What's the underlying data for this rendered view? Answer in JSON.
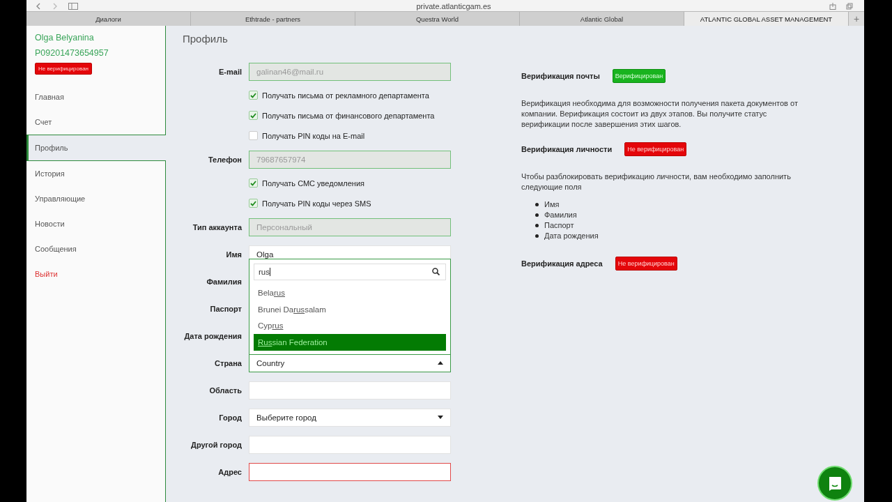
{
  "browser": {
    "url": "private.atlanticgam.es",
    "tabs": [
      {
        "label": "Диалоги",
        "selected": false
      },
      {
        "label": "Ethtrade - partners",
        "selected": false
      },
      {
        "label": "Questra World",
        "selected": false
      },
      {
        "label": "Atlantic Global",
        "selected": false
      },
      {
        "label": "ATLANTIC GLOBAL ASSET MANAGEMENT",
        "selected": true
      }
    ],
    "new_tab": "+"
  },
  "sidebar": {
    "name": "Olga Belyanina",
    "account_id": "P09201473654957",
    "status": {
      "label": "Не верифицирован",
      "verified": false
    },
    "items": [
      {
        "label": "Главная",
        "selected": false,
        "kind": "nav"
      },
      {
        "label": "Счет",
        "selected": false,
        "kind": "nav"
      },
      {
        "label": "Профиль",
        "selected": true,
        "kind": "nav"
      },
      {
        "label": "История",
        "selected": false,
        "kind": "nav"
      },
      {
        "label": "Управляющие",
        "selected": false,
        "kind": "nav"
      },
      {
        "label": "Новости",
        "selected": false,
        "kind": "nav"
      },
      {
        "label": "Сообщения",
        "selected": false,
        "kind": "nav"
      },
      {
        "label": "Выйти",
        "selected": false,
        "kind": "logout"
      }
    ]
  },
  "page_title": "Профиль",
  "form": [
    {
      "kind": "field",
      "label": "E-mail",
      "value": "galinan46@mail.ru",
      "disabled": true,
      "error": false
    },
    {
      "kind": "checkbox",
      "label": "Получать письма от рекламного департамента",
      "checked": true
    },
    {
      "kind": "checkbox",
      "label": "Получать письма от финансового департамента",
      "checked": true
    },
    {
      "kind": "checkbox",
      "label": "Получать PIN коды на E-mail",
      "checked": false
    },
    {
      "kind": "field",
      "label": "Телефон",
      "value": "79687657974",
      "disabled": true,
      "error": false
    },
    {
      "kind": "checkbox",
      "label": "Получать СМС уведомления",
      "checked": true
    },
    {
      "kind": "checkbox",
      "label": "Получать PIN коды через SMS",
      "checked": true
    },
    {
      "kind": "field",
      "label": "Тип аккаунта",
      "value": "Персональный",
      "disabled": true,
      "error": false
    },
    {
      "kind": "field",
      "label": "Имя",
      "value": "Olga",
      "disabled": false,
      "error": false
    },
    {
      "kind": "covered",
      "label": "Фамилия"
    },
    {
      "kind": "covered",
      "label": "Паспорт"
    },
    {
      "kind": "covered",
      "label": "Дата рождения"
    },
    {
      "kind": "country",
      "label": "Страна",
      "value": "Country",
      "expanded": true,
      "search": "rus",
      "options": [
        {
          "before": "Bela",
          "match": "rus",
          "selected": false
        },
        {
          "before": "Brunei Da",
          "match": "rus",
          "after": "salam",
          "selected": false
        },
        {
          "before": "Cyp",
          "match": "rus",
          "selected": false
        },
        {
          "match": "Rus",
          "after": "sian Federation",
          "selected": true
        }
      ]
    },
    {
      "kind": "field",
      "label": "Область",
      "disabled": false,
      "error": false
    },
    {
      "kind": "select",
      "label": "Город",
      "value": "Выберите город"
    },
    {
      "kind": "field",
      "label": "Другой город",
      "disabled": false,
      "error": false
    },
    {
      "kind": "field",
      "label": "Адрес",
      "disabled": false,
      "error": true
    }
  ],
  "verification": [
    {
      "title": "Верификация почты",
      "status": "Верифицирован",
      "verified": true,
      "text": "Верификация необходима для возможности получения пакета документов от компании. Верификация состоит из двух этапов. Вы получите статус верификации после завершения этих шагов."
    },
    {
      "title": "Верификация личности",
      "status": "Не верифицирован",
      "verified": false,
      "text": "Чтобы разблокировать верификацию личности, вам необходимо заполнить следующие поля",
      "list": [
        "Имя",
        "Фамилия",
        "Паспорт",
        "Дата рождения"
      ]
    },
    {
      "title": "Верификация адреса",
      "status": "Не верифицирован",
      "verified": false
    }
  ]
}
